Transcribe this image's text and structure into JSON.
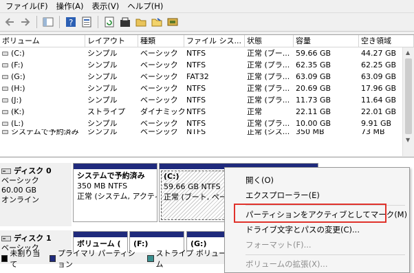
{
  "menu": [
    "ファイル(F)",
    "操作(A)",
    "表示(V)",
    "ヘルプ(H)"
  ],
  "toolbar_icons": [
    "back-icon",
    "forward-icon",
    "console-tree-icon",
    "help-icon",
    "properties-icon",
    "refresh-icon",
    "settings-icon",
    "open-folder-icon",
    "open-icon",
    "disk-check-icon"
  ],
  "volume_list": {
    "columns": [
      "ボリューム",
      "レイアウト",
      "種類",
      "ファイル シス...",
      "状態",
      "容量",
      "空き領域"
    ],
    "rows": [
      [
        "(C:)",
        "シンプル",
        "ベーシック",
        "NTFS",
        "正常 (ブー...",
        "59.66 GB",
        "44.27 GB"
      ],
      [
        "(F:)",
        "シンプル",
        "ベーシック",
        "NTFS",
        "正常 (プラ...",
        "62.35 GB",
        "62.25 GB"
      ],
      [
        "(G:)",
        "シンプル",
        "ベーシック",
        "FAT32",
        "正常 (プラ...",
        "63.09 GB",
        "63.09 GB"
      ],
      [
        "(H:)",
        "シンプル",
        "ベーシック",
        "NTFS",
        "正常 (プラ...",
        "20.69 GB",
        "17.96 GB"
      ],
      [
        "(J:)",
        "シンプル",
        "ベーシック",
        "NTFS",
        "正常 (プラ...",
        "11.73 GB",
        "11.64 GB"
      ],
      [
        "(K:)",
        "ストライプ",
        "ダイナミック",
        "NTFS",
        "正常",
        "22.11 GB",
        "22.01 GB"
      ],
      [
        "(L:)",
        "シンプル",
        "ベーシック",
        "NTFS",
        "正常 (プラ...",
        "10.00 GB",
        "9.91 GB"
      ],
      [
        "システムで予約済み",
        "シンプル",
        "ベーシック",
        "NTFS",
        "正常 (シス...",
        "350 MB",
        "73 MB"
      ]
    ]
  },
  "disk0": {
    "title": "ディスク 0",
    "type": "ベーシック",
    "size": "60.00 GB",
    "status": "オンライン",
    "p1_name": "システムで予約済み",
    "p1_size": "350 MB NTFS",
    "p1_status": "正常 (システム, アクティ",
    "p2_name": "(C:)",
    "p2_size": "59.66 GB NTFS",
    "p2_status": "正常 (ブート, ペー"
  },
  "disk1": {
    "title": "ディスク 1",
    "type": "ベーシック",
    "p1_name": "ボリューム (",
    "p2_name": "(F:)",
    "p3_name": "(G:)"
  },
  "legend": [
    {
      "label": "未割り当て",
      "color": "#000000"
    },
    {
      "label": "プライマリ パーティション",
      "color": "#1f2a7c"
    },
    {
      "label": "ストライプ ボリューム",
      "color": "#3a8f8f"
    }
  ],
  "context_menu": {
    "open": "開く(O)",
    "explorer": "エクスプローラー(E)",
    "mark_active": "パーティションをアクティブとしてマーク(M)",
    "change_letter": "ドライブ文字とパスの変更(C)...",
    "format": "フォーマット(F)...",
    "extend": "ボリュームの拡張(X)..."
  }
}
